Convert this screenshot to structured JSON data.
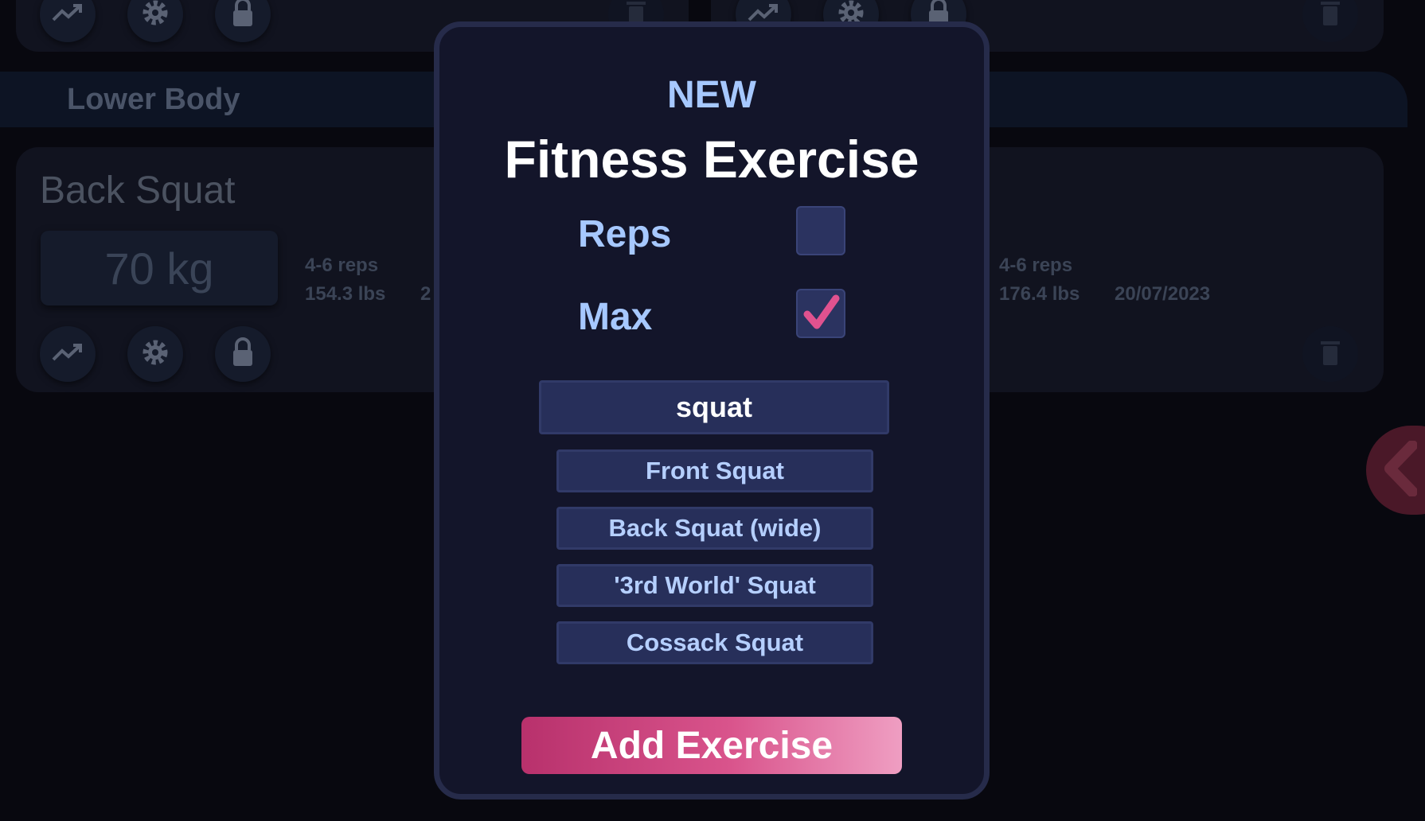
{
  "section": {
    "title": "Lower Body"
  },
  "cards": [
    {
      "name": "Back Squat",
      "weight": "70 kg",
      "reps": "4-6 reps",
      "lbs": "154.3 lbs",
      "date_fragment": "2"
    },
    {
      "reps": "4-6 reps",
      "lbs": "176.4 lbs",
      "date": "20/07/2023"
    }
  ],
  "icons": {
    "trend": "trending-up-icon",
    "settings": "gear-icon",
    "lock": "lock-icon",
    "delete": "trash-icon",
    "side": "chevron-left-icon"
  },
  "modal": {
    "eyebrow": "NEW",
    "title": "Fitness Exercise",
    "options": [
      {
        "label": "Reps",
        "checked": false
      },
      {
        "label": "Max",
        "checked": true
      }
    ],
    "search_value": "squat",
    "suggestions": [
      "Front Squat",
      "Back Squat (wide)",
      "'3rd World' Squat",
      "Cossack Squat"
    ],
    "submit_label": "Add Exercise"
  },
  "colors": {
    "accent": "#e0528f",
    "label": "#a6c8ff",
    "modal_bg": "#13152a"
  }
}
